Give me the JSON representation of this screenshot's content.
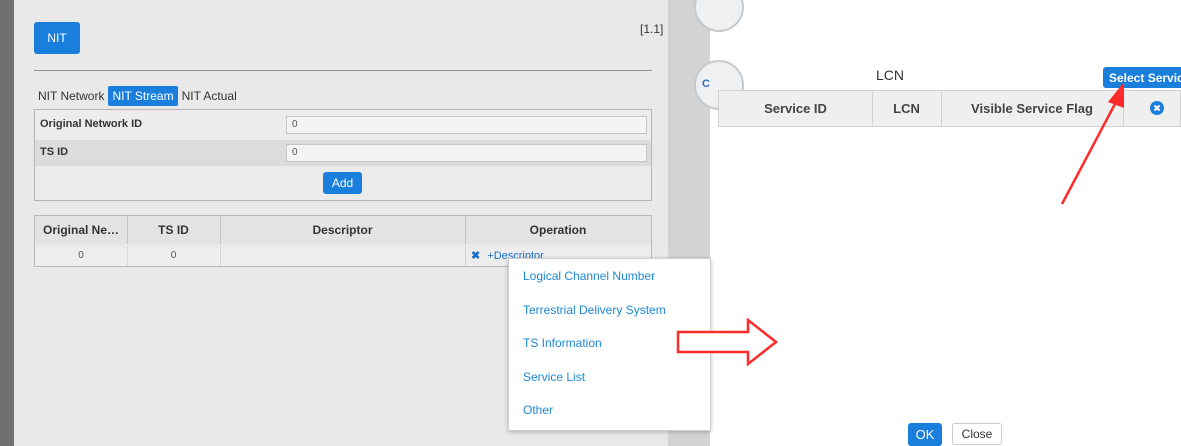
{
  "left": {
    "nit_button": "NIT",
    "page_indicator": "[1.1]",
    "tabs": [
      "NIT Network",
      "NIT Stream",
      "NIT Actual"
    ],
    "active_tab": "NIT Stream",
    "form": {
      "original_network_id_label": "Original Network ID",
      "original_network_id_value": "0",
      "ts_id_label": "TS ID",
      "ts_id_value": "0",
      "add_button": "Add"
    },
    "table": {
      "headers": [
        "Original Ne…",
        "TS ID",
        "Descriptor",
        "Operation"
      ],
      "rows": [
        {
          "original_network_id": "0",
          "ts_id": "0",
          "descriptor": "",
          "op_delete": "✖",
          "op_add": "+Descriptor"
        }
      ]
    },
    "descriptor_menu": [
      "Logical Channel Number",
      "Terrestrial Delivery System",
      "TS Information",
      "Service List",
      "Other"
    ]
  },
  "dialog": {
    "title": "LCN",
    "select_service_button": "Select Servic",
    "headers": [
      "Service ID",
      "LCN",
      "Visible Service Flag"
    ],
    "ok_button": "OK",
    "close_button": "Close"
  },
  "colors": {
    "accent": "#1a7fdc",
    "annotation_red": "#ff2a2a"
  }
}
